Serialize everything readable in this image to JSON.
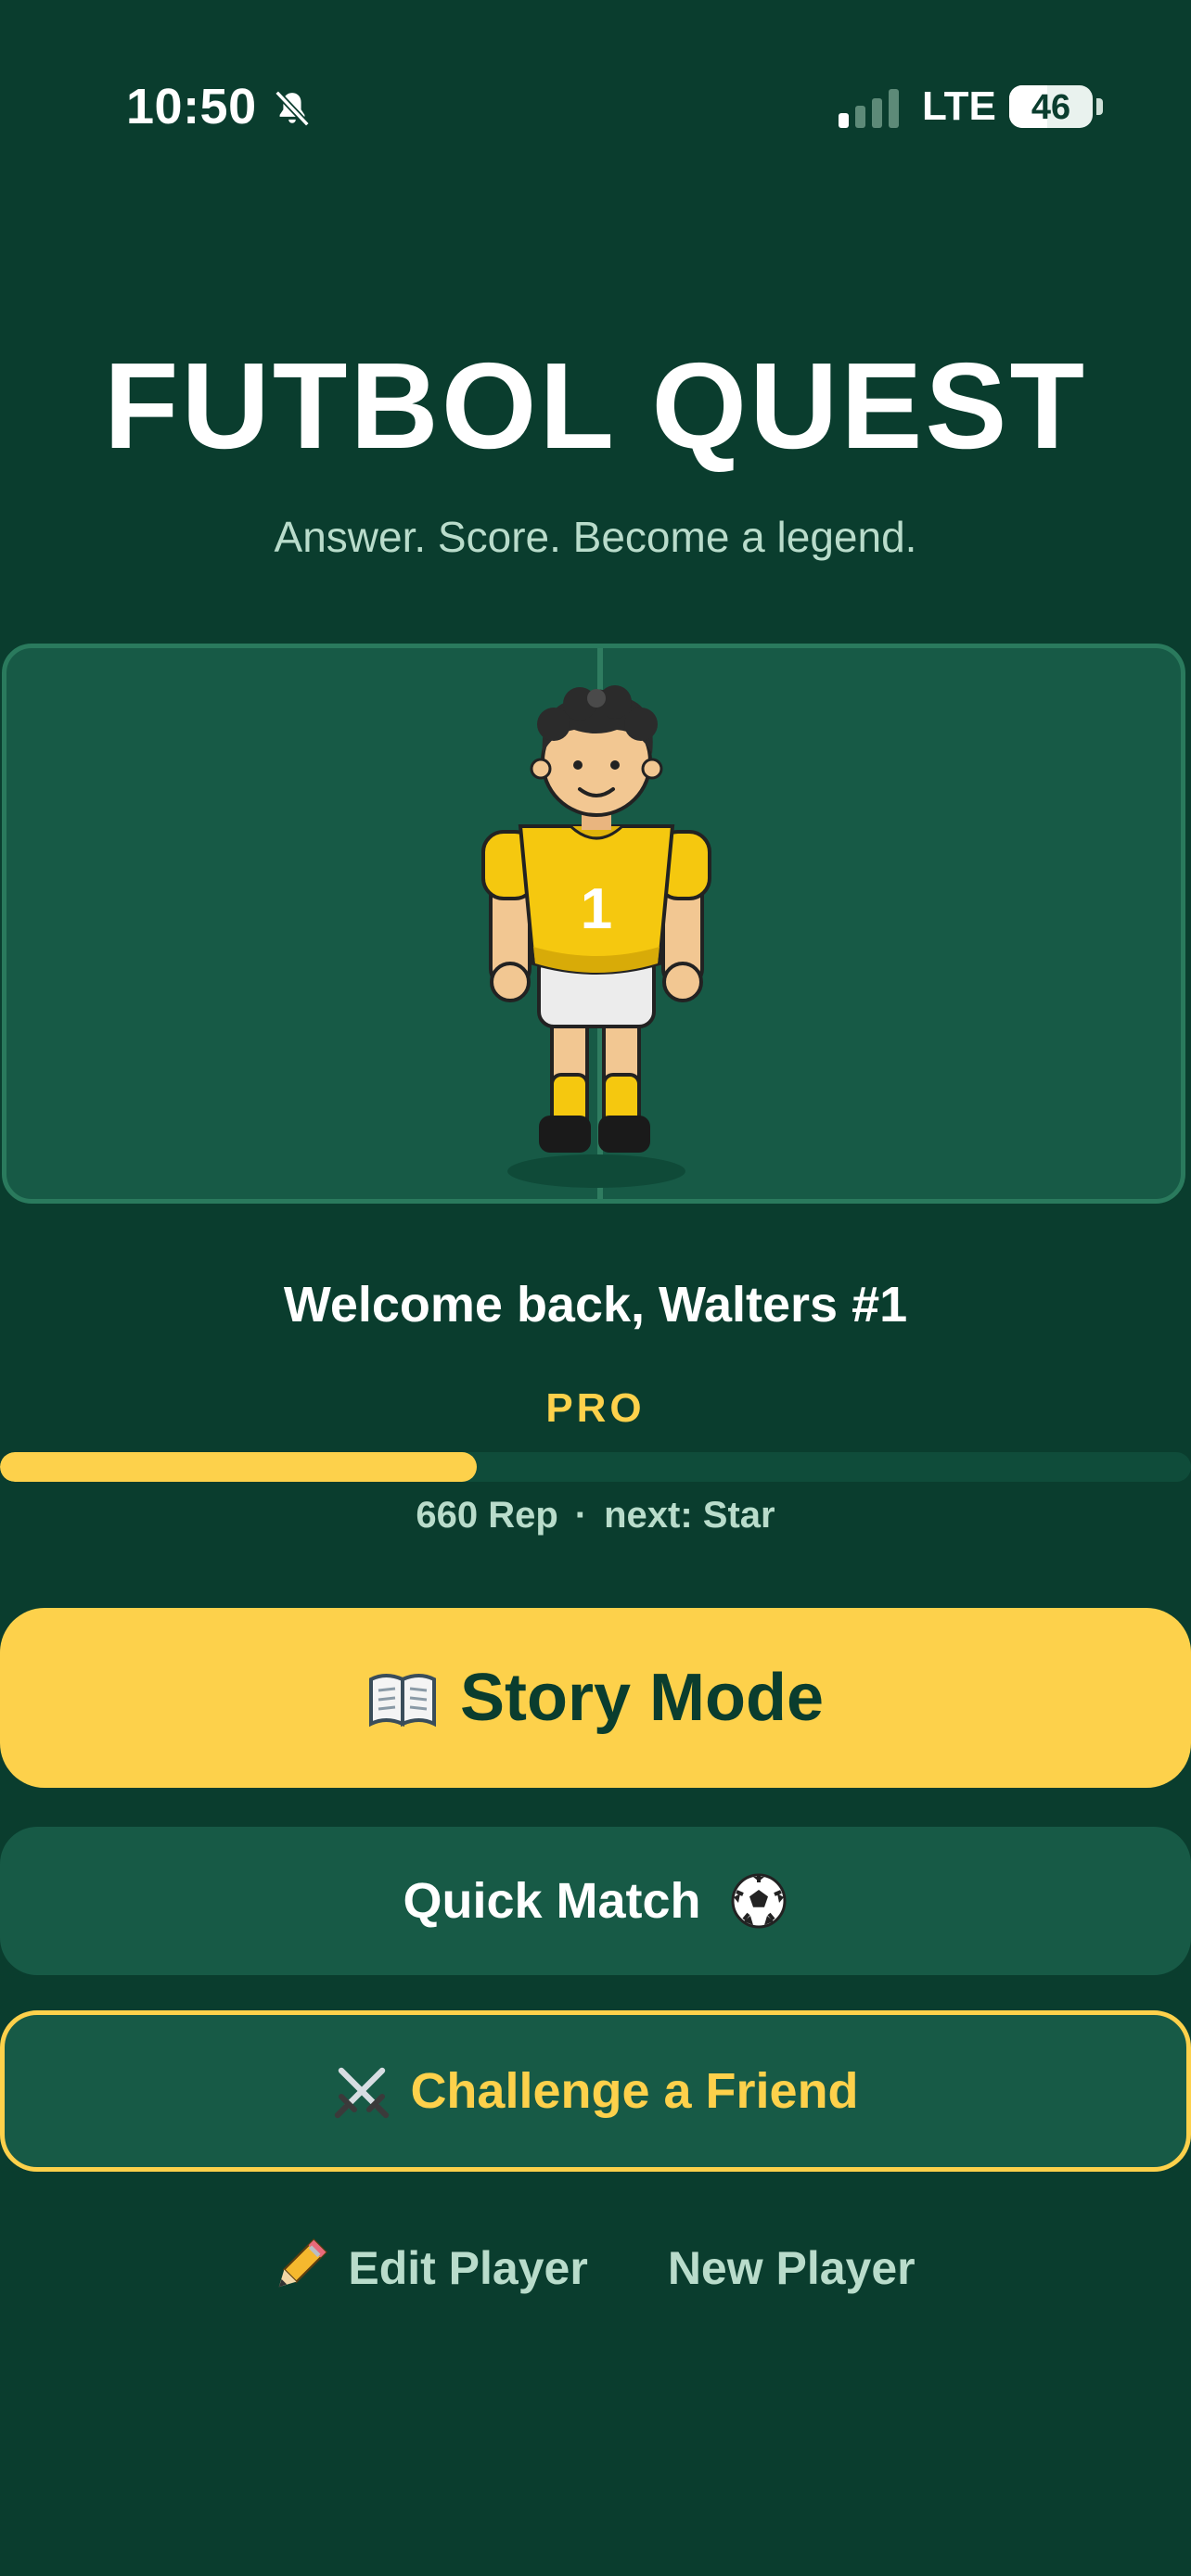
{
  "status_bar": {
    "time": "10:50",
    "network": "LTE",
    "battery_level": "46",
    "battery_fraction": 0.46,
    "signal_bars_active": 1,
    "signal_bars_total": 4,
    "icons": [
      "bell-slash-icon",
      "signal-icon",
      "battery-icon"
    ]
  },
  "header": {
    "title": "FUTBOL QUEST",
    "subtitle": "Answer. Score. Become a legend."
  },
  "player": {
    "jersey_number": "1",
    "welcome": "Welcome back, Walters #1",
    "rank": "PRO",
    "rep": "660 Rep",
    "separator": "·",
    "next_rank": "next: Star",
    "progress_fraction": 0.4
  },
  "buttons": {
    "story_mode": "Story Mode",
    "quick_match": "Quick Match",
    "challenge": "Challenge a Friend"
  },
  "footer": {
    "edit_player": "Edit Player",
    "new_player": "New Player"
  },
  "colors": {
    "background": "#0a3d2e",
    "card": "#175a46",
    "accent_yellow": "#fdd14b",
    "muted_text": "#b9dccb"
  }
}
